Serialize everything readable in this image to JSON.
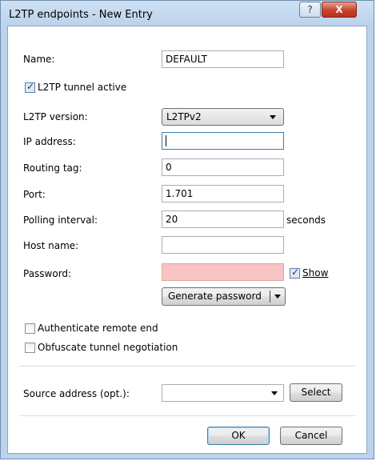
{
  "window": {
    "title": "L2TP endpoints - New Entry"
  },
  "titlebar": {
    "help_glyph": "?",
    "close_glyph": "X"
  },
  "form": {
    "name": {
      "label": "Name:",
      "value": "DEFAULT"
    },
    "tunnel_active": {
      "label": "L2TP tunnel active",
      "checked": true
    },
    "version": {
      "label": "L2TP version:",
      "value": "L2TPv2"
    },
    "ip_address": {
      "label": "IP address:",
      "value": ""
    },
    "routing_tag": {
      "label": "Routing tag:",
      "value": "0"
    },
    "port": {
      "label": "Port:",
      "value": "1.701"
    },
    "polling_interval": {
      "label": "Polling interval:",
      "value": "20",
      "unit": "seconds"
    },
    "host_name": {
      "label": "Host name:",
      "value": ""
    },
    "password": {
      "label": "Password:",
      "value": "",
      "show_label": "Show",
      "show_checked": true
    },
    "generate_password": {
      "label": "Generate password"
    },
    "authenticate_remote": {
      "label": "Authenticate remote end",
      "checked": false
    },
    "obfuscate": {
      "label": "Obfuscate tunnel negotiation",
      "checked": false
    },
    "source_address": {
      "label": "Source address (opt.):",
      "value": "",
      "select_label": "Select"
    }
  },
  "buttons": {
    "ok": "OK",
    "cancel": "Cancel"
  },
  "colors": {
    "password_invalid_bg": "#f9c4c4",
    "window_frame": "#bcd3ec"
  }
}
